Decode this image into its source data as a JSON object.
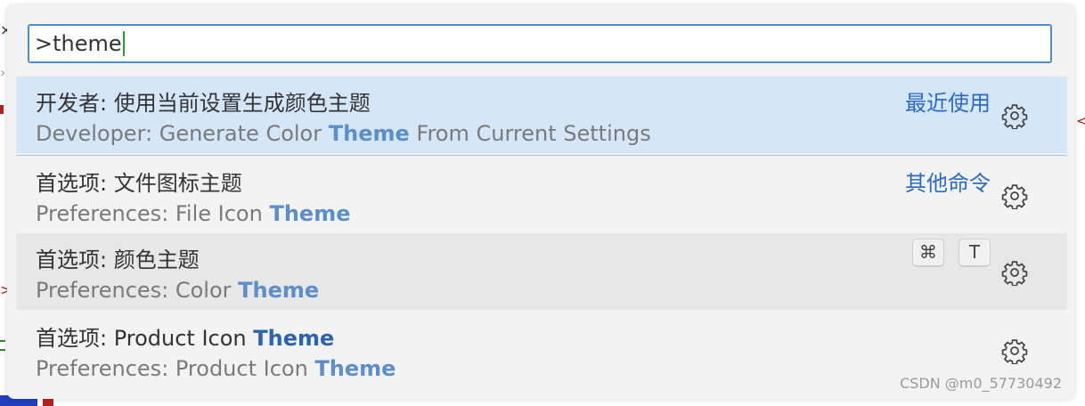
{
  "palette": {
    "input": {
      "value": ">theme"
    },
    "items": [
      {
        "label": "开发者: 使用当前设置生成颜色主题",
        "detail_prefix": "Developer: Generate Color ",
        "detail_match": "Theme",
        "detail_suffix": " From Current Settings",
        "tag": "最近使用",
        "selected": true
      },
      {
        "label": "首选项: 文件图标主题",
        "detail_prefix": "Preferences: File Icon ",
        "detail_match": "Theme",
        "tag": "其他命令"
      },
      {
        "label": "首选项: 颜色主题",
        "detail_prefix": "Preferences: Color ",
        "detail_match": "Theme",
        "keybinding": [
          "⌘",
          "T"
        ],
        "hovered": true
      },
      {
        "label_prefix": "首选项: Product Icon ",
        "label_match": "Theme",
        "detail_prefix": "Preferences: Product Icon ",
        "detail_match": "Theme"
      }
    ]
  },
  "watermark": "CSDN @m0_57730492",
  "colors": {
    "accent": "#4a8fd6",
    "selected_row": "#d6e6f9",
    "hovered_row": "#e7e7e7",
    "highlight_text": "#2a63b2",
    "tag_text": "#2a6bc3"
  },
  "icons": {
    "gear": "gear-icon",
    "edge_glyphs": [
      "close-icon",
      "chevron-right-icon"
    ]
  }
}
